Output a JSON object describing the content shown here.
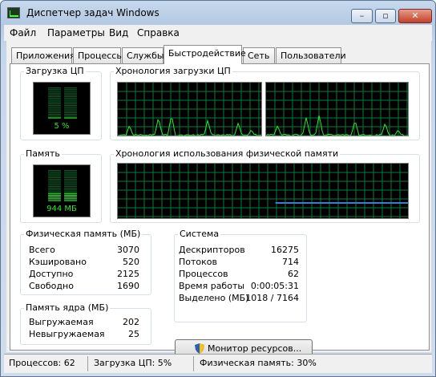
{
  "window": {
    "title": "Диспетчер задач Windows"
  },
  "menu": [
    "Файл",
    "Параметры",
    "Вид",
    "Справка"
  ],
  "tabs": [
    "Приложения",
    "Процессы",
    "Службы",
    "Быстродействие",
    "Сеть",
    "Пользователи"
  ],
  "active_tab": "Быстродействие",
  "cpu": {
    "label": "Загрузка ЦП",
    "value": "5 %",
    "percent": 5
  },
  "cpu_history": {
    "label": "Хронология загрузки ЦП"
  },
  "memory": {
    "label": "Память",
    "value": "944 МБ",
    "percent": 30
  },
  "memory_history": {
    "label": "Хронология использования физической памяти"
  },
  "physical_memory": {
    "label": "Физическая память (МБ)",
    "rows": [
      {
        "label": "Всего",
        "value": "3070"
      },
      {
        "label": "Кэшировано",
        "value": "520"
      },
      {
        "label": "Доступно",
        "value": "2125"
      },
      {
        "label": "Свободно",
        "value": "1690"
      }
    ]
  },
  "kernel_memory": {
    "label": "Память ядра (МБ)",
    "rows": [
      {
        "label": "Выгружаемая",
        "value": "202"
      },
      {
        "label": "Невыгружаемая",
        "value": "25"
      }
    ]
  },
  "system": {
    "label": "Система",
    "rows": [
      {
        "label": "Дескрипторов",
        "value": "16275"
      },
      {
        "label": "Потоков",
        "value": "714"
      },
      {
        "label": "Процессов",
        "value": "62"
      },
      {
        "label": "Время работы",
        "value": "0:00:05:31"
      },
      {
        "label": "Выделено (МБ)",
        "value": "1018 / 7164"
      }
    ]
  },
  "resource_monitor_button": "Монитор ресурсов...",
  "status": {
    "processes": "Процессов: 62",
    "cpu": "Загрузка ЦП: 5%",
    "memory": "Физическая память: 30%"
  },
  "colors": {
    "graph_green": "#2fe82f",
    "grid_green": "#0c7a3e",
    "memory_line": "#3a7bd5"
  }
}
